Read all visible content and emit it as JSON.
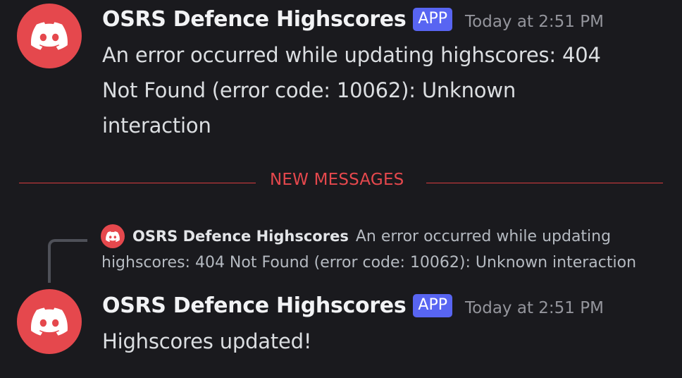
{
  "messages": [
    {
      "author": "OSRS Defence Highscores",
      "tag": "APP",
      "timestamp": "Today at 2:51 PM",
      "lines": [
        "An error occurred while updating highscores: 404",
        "Not Found (error code: 10062): Unknown",
        "interaction"
      ]
    },
    {
      "author": "OSRS Defence Highscores",
      "tag": "APP",
      "timestamp": "Today at 2:51 PM",
      "lines": [
        "Highscores updated!"
      ]
    }
  ],
  "divider": {
    "label": "NEW MESSAGES"
  },
  "reply": {
    "author": "OSRS Defence Highscores",
    "text_part1": "An error occurred while updating",
    "text_part2": "highscores: 404 Not Found (error code: 10062): Unknown interaction"
  },
  "icons": {
    "avatar": "discord-logo-icon"
  },
  "colors": {
    "background": "#1a1a1e",
    "avatar": "#e5484d",
    "app_tag": "#5865f2",
    "new_messages": "#e5484d"
  }
}
